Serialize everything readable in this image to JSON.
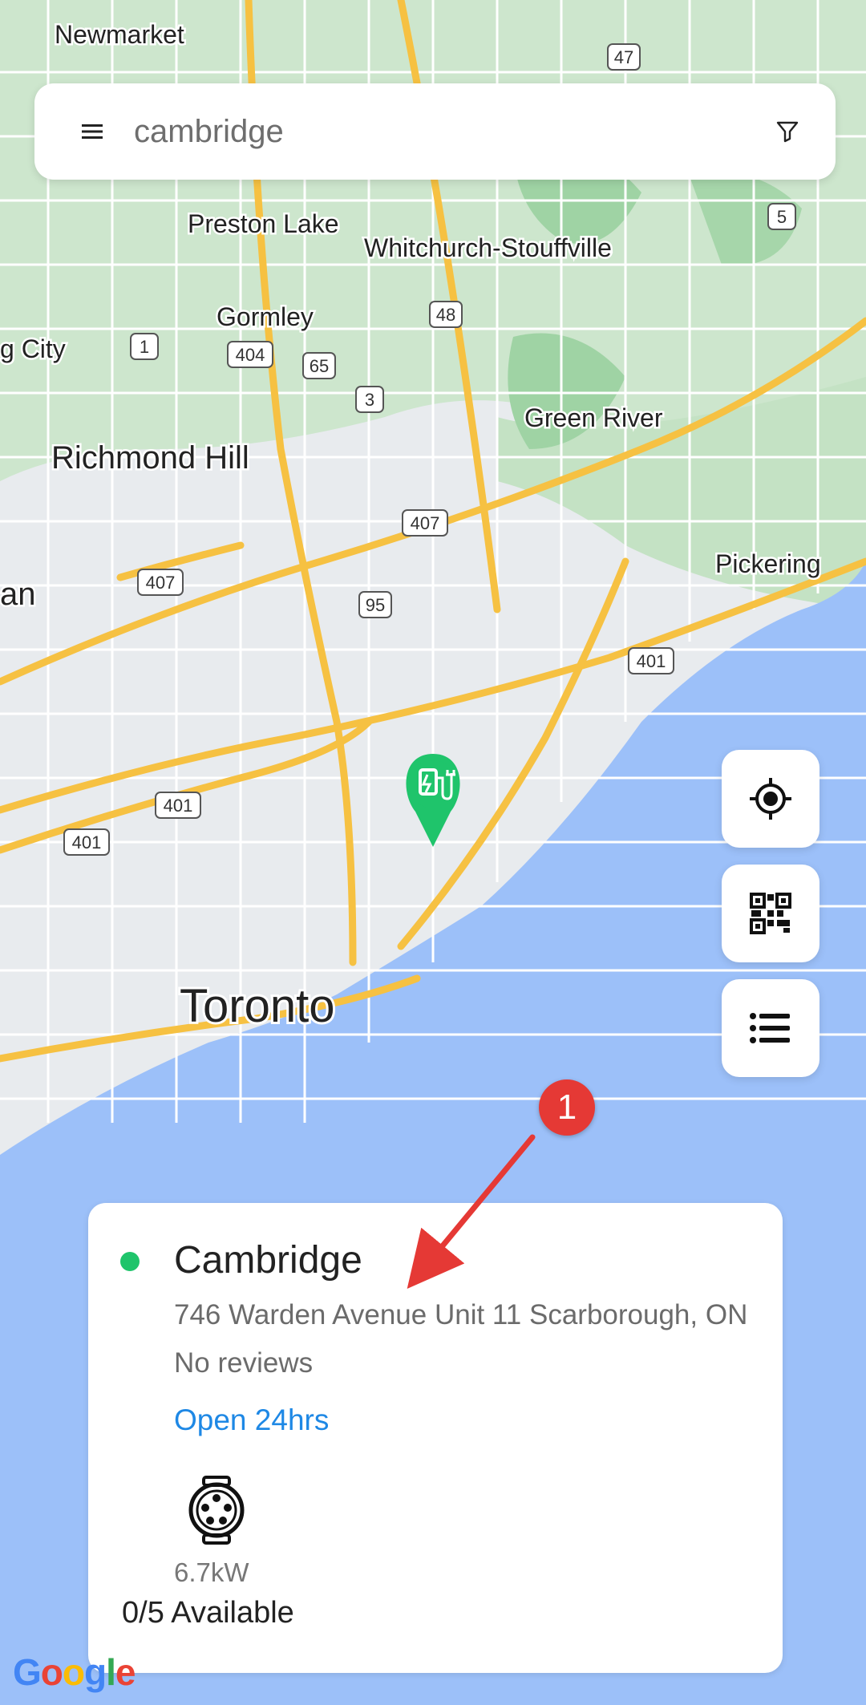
{
  "search": {
    "query": "cambridge",
    "menu_icon": "hamburger-menu-icon",
    "filter_icon": "filter-icon"
  },
  "map": {
    "places": {
      "newmarket": "Newmarket",
      "preston_lake": "Preston Lake",
      "whitchurch": "Whitchurch-Stouffville",
      "gormley": "Gormley",
      "g_city": "g City",
      "richmond_hill": "Richmond Hill",
      "green_river": "Green River",
      "pickering": "Pickering",
      "an": "an",
      "toronto": "Toronto"
    },
    "shields": {
      "h47": "47",
      "h5": "5",
      "h48": "48",
      "h1": "1",
      "h404": "404",
      "h65": "65",
      "h3": "3",
      "h407a": "407",
      "h407b": "407",
      "h95": "95",
      "h401a": "401",
      "h401b": "401",
      "h401c": "401"
    },
    "colors": {
      "water": "#9cc0f9",
      "land": "#e9ecef",
      "park": "#cfe8cf",
      "highway": "#f6c142",
      "marker": "#1fc46b"
    },
    "attribution": "Google"
  },
  "controls": {
    "locate_icon": "crosshair-icon",
    "qr_icon": "qr-code-icon",
    "list_icon": "list-icon"
  },
  "station": {
    "name": "Cambridge",
    "address": "746 Warden Avenue Unit 11 Scarborough, ON",
    "reviews": "No reviews",
    "hours": "Open 24hrs",
    "connector_icon": "ev-connector-icon",
    "power": "6.7kW",
    "availability": "0/5 Available",
    "status_color": "#1fc46b"
  },
  "annotation": {
    "badge": "1",
    "color": "#e53935"
  }
}
